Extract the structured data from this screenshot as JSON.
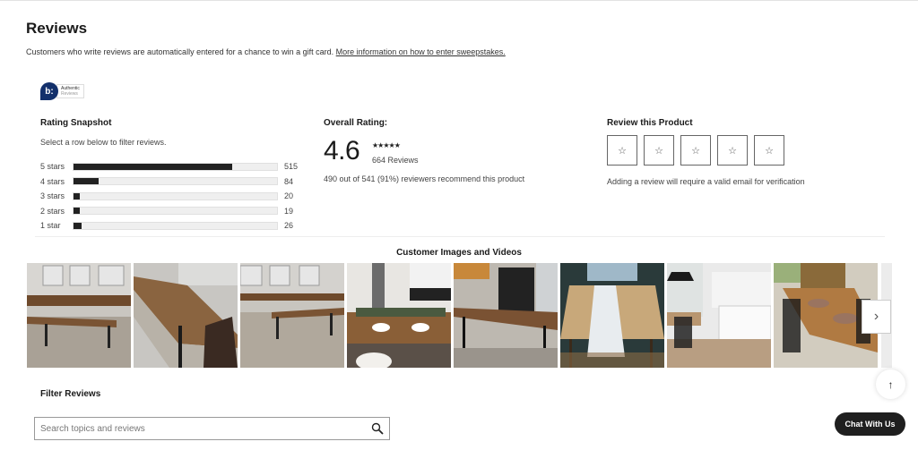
{
  "header": {
    "title": "Reviews",
    "intro_text": "Customers who write reviews are automatically entered for a chance to win a gift card.",
    "intro_link": "More information on how to enter sweepstakes."
  },
  "badge": {
    "logo": "b:",
    "line1": "Authentic",
    "line2": "Reviews",
    "brand_color": "#13306b"
  },
  "snapshot": {
    "title": "Rating Snapshot",
    "subtitle": "Select a row below to filter reviews.",
    "rows": [
      {
        "label": "5 stars",
        "count": "515",
        "fraction": 0.78
      },
      {
        "label": "4 stars",
        "count": "84",
        "fraction": 0.125
      },
      {
        "label": "3 stars",
        "count": "20",
        "fraction": 0.03
      },
      {
        "label": "2 stars",
        "count": "19",
        "fraction": 0.03
      },
      {
        "label": "1 star",
        "count": "26",
        "fraction": 0.04
      }
    ]
  },
  "overall": {
    "title": "Overall Rating:",
    "rating": "4.6",
    "stars_glyph": "★★★★★",
    "review_count": "664 Reviews",
    "recommend": "490 out of 541 (91%) reviewers recommend this product"
  },
  "review_product": {
    "title": "Review this Product",
    "star_glyph": "☆",
    "star_count": 5,
    "note": "Adding a review will require a valid email for verification"
  },
  "gallery": {
    "title": "Customer Images and Videos",
    "images": [
      {
        "name": "dining-table-bench-windows"
      },
      {
        "name": "wood-table-closeup-chair"
      },
      {
        "name": "table-bench-windows-2"
      },
      {
        "name": "set-table-place-settings"
      },
      {
        "name": "table-dark-hutch"
      },
      {
        "name": "table-with-runner"
      },
      {
        "name": "kitchen-island-table"
      },
      {
        "name": "table-windsor-chairs"
      }
    ],
    "next_icon": "›"
  },
  "filter": {
    "title": "Filter Reviews",
    "search_placeholder": "Search topics and reviews",
    "search_value": ""
  },
  "floating": {
    "up_icon": "↑",
    "chat_label": "Chat With Us"
  }
}
